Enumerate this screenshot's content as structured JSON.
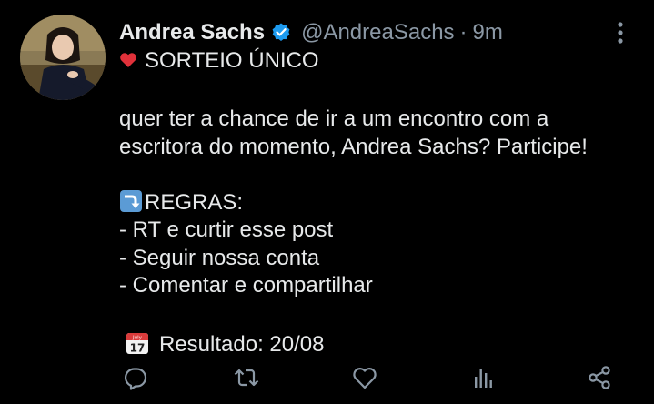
{
  "tweet": {
    "author_name": "Andrea Sachs",
    "handle": "@AndreaSachs",
    "separator": "·",
    "time": "9m",
    "lines": {
      "title": "SORTEIO ÚNICO",
      "intro_1": " quer ter a chance de ir a um encontro com a",
      "intro_2": "escritora do momento, Andrea Sachs? Participe!",
      "rules_title": "REGRAS:",
      "rule_1": "- RT e curtir esse post",
      "rule_2": "- Seguir nossa conta",
      "rule_3": "- Comentar e compartilhar",
      "result": "Resultado: 20/08"
    },
    "emojis": {
      "title": "heart-emoji",
      "rules": "right-arrow-curving-down-emoji",
      "result": "calendar-emoji"
    },
    "calendar_emoji_text": {
      "month": "July",
      "day": "17"
    }
  },
  "icons": {
    "verified": "verified-badge-icon",
    "more": "more-vertical-icon",
    "reply": "reply-icon",
    "retweet": "retweet-icon",
    "like": "like-icon",
    "analytics": "analytics-icon",
    "share": "share-icon"
  },
  "colors": {
    "background": "#000000",
    "text_primary": "#e7e9ea",
    "text_secondary": "#8b98a5",
    "verified_blue": "#1d9bf0",
    "heart_red": "#e0313a"
  }
}
